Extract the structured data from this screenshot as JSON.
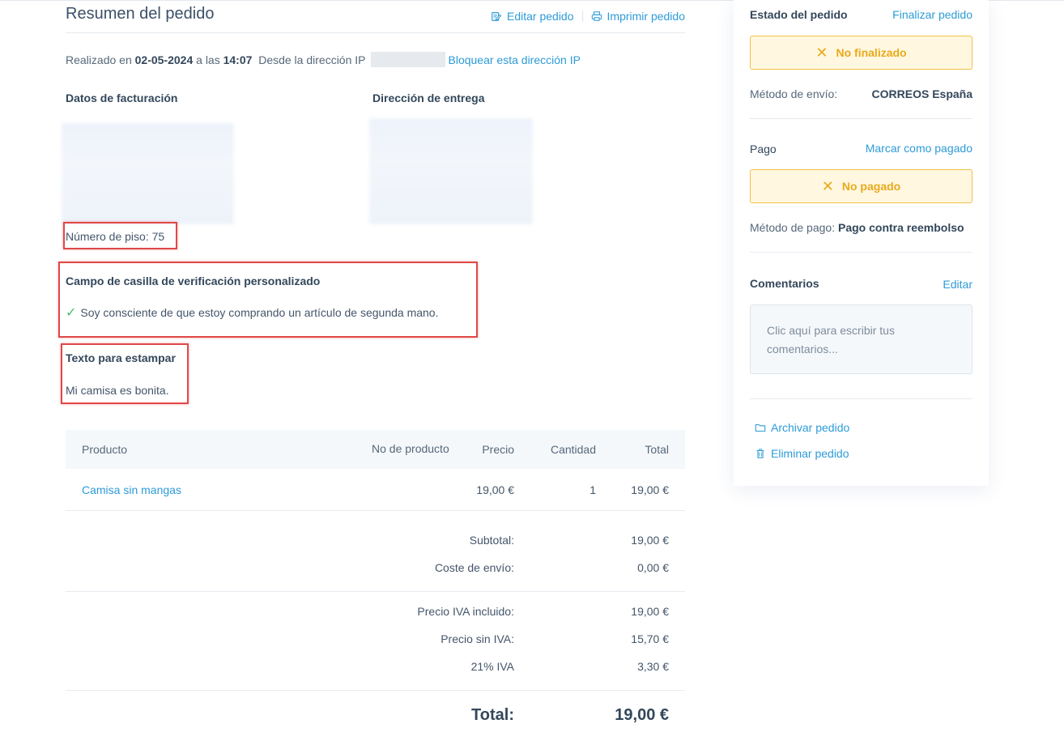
{
  "header": {
    "title": "Resumen del pedido",
    "edit_label": "Editar pedido",
    "print_label": "Imprimir pedido"
  },
  "meta": {
    "prefix": "Realizado en",
    "date": "02-05-2024",
    "at": "a las",
    "time": "14:07",
    "from_ip": "Desde la dirección IP",
    "block_ip_label": "Bloquear esta dirección IP"
  },
  "billing": {
    "heading": "Datos de facturación",
    "floor_number": "Número de piso: 75"
  },
  "shipping": {
    "heading": "Dirección de entrega"
  },
  "custom_checkbox": {
    "heading": "Campo de casilla de verificación personalizado",
    "value": "Soy consciente de que estoy comprando un artículo de segunda mano."
  },
  "custom_text": {
    "heading": "Texto para estampar",
    "value": "Mi camisa es bonita."
  },
  "products": {
    "columns": {
      "product": "Producto",
      "sku": "No de producto",
      "price": "Precio",
      "quantity": "Cantidad",
      "total": "Total"
    },
    "rows": [
      {
        "name": "Camisa sin mangas",
        "sku": "",
        "price": "19,00 €",
        "quantity": "1",
        "total": "19,00 €"
      }
    ]
  },
  "totals": {
    "subtotal_label": "Subtotal:",
    "subtotal": "19,00 €",
    "shipping_label": "Coste de envío:",
    "shipping": "0,00 €",
    "vat_included_label": "Precio IVA incluido:",
    "vat_included": "19,00 €",
    "no_vat_label": "Precio sin IVA:",
    "no_vat": "15,70 €",
    "vat_label": "21% IVA",
    "vat": "3,30 €",
    "total_label": "Total:",
    "total": "19,00 €"
  },
  "sidebar": {
    "order_status_label": "Estado del pedido",
    "finalize_label": "Finalizar pedido",
    "order_status": "No finalizado",
    "shipping_method_label": "Método de envío:",
    "shipping_method": "CORREOS España",
    "payment_label": "Pago",
    "mark_paid_label": "Marcar como pagado",
    "payment_status": "No pagado",
    "payment_method_label": "Método de pago:",
    "payment_method": "Pago contra reembolso",
    "comments_label": "Comentarios",
    "edit_label": "Editar",
    "comments_placeholder": "Clic aquí para escribir tus comentarios...",
    "archive_label": "Archivar pedido",
    "delete_label": "Eliminar pedido"
  },
  "colors": {
    "accent": "#2d9bd8",
    "warning_bg": "#fff7e0",
    "warning_border": "#f1c247",
    "warning_text": "#e8aa1c",
    "highlight_border": "#e04848",
    "check": "#3fbf6f"
  }
}
